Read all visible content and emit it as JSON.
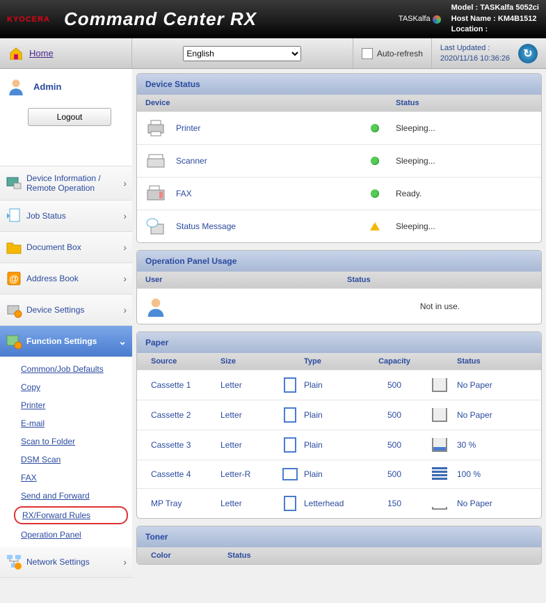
{
  "brand": "KYOCERA",
  "product": "Command Center",
  "product_suffix": "RX",
  "taskalfa": "TASKalfa",
  "host": {
    "model_label": "Model :",
    "model": "TASKalfa 5052ci",
    "hostname_label": "Host Name :",
    "hostname": "KM4B1512",
    "location_label": "Location :",
    "location": ""
  },
  "topbar": {
    "home": "Home",
    "language": "English",
    "auto_refresh": "Auto-refresh",
    "last_updated_label": "Last Updated :",
    "last_updated": "2020/11/16 10:36:26"
  },
  "user": {
    "name": "Admin",
    "logout": "Logout"
  },
  "nav": [
    {
      "label": "Device Information / Remote Operation"
    },
    {
      "label": "Job Status"
    },
    {
      "label": "Document Box"
    },
    {
      "label": "Address Book"
    },
    {
      "label": "Device Settings"
    },
    {
      "label": "Function Settings",
      "active": true
    },
    {
      "label": "Network Settings"
    }
  ],
  "function_settings_sub": [
    "Common/Job Defaults",
    "Copy",
    "Printer",
    "E-mail",
    "Scan to Folder",
    "DSM Scan",
    "FAX",
    "Send and Forward",
    "RX/Forward Rules",
    "Operation Panel"
  ],
  "device_status": {
    "title": "Device Status",
    "cols": {
      "device": "Device",
      "status": "Status"
    },
    "rows": [
      {
        "name": "Printer",
        "status": "Sleeping...",
        "ind": "ok"
      },
      {
        "name": "Scanner",
        "status": "Sleeping...",
        "ind": "ok"
      },
      {
        "name": "FAX",
        "status": "Ready.",
        "ind": "ok"
      },
      {
        "name": "Status Message",
        "status": "Sleeping...",
        "ind": "warn"
      }
    ]
  },
  "op_panel": {
    "title": "Operation Panel Usage",
    "cols": {
      "user": "User",
      "status": "Status"
    },
    "status": "Not in use."
  },
  "paper": {
    "title": "Paper",
    "cols": {
      "source": "Source",
      "size": "Size",
      "type": "Type",
      "capacity": "Capacity",
      "status": "Status"
    },
    "rows": [
      {
        "source": "Cassette 1",
        "size": "Letter",
        "orient": "p",
        "type": "Plain",
        "capacity": "500",
        "level": "none",
        "status": "No Paper"
      },
      {
        "source": "Cassette 2",
        "size": "Letter",
        "orient": "p",
        "type": "Plain",
        "capacity": "500",
        "level": "none",
        "status": "No Paper"
      },
      {
        "source": "Cassette 3",
        "size": "Letter",
        "orient": "p",
        "type": "Plain",
        "capacity": "500",
        "level": "p30",
        "status": "30 %"
      },
      {
        "source": "Cassette 4",
        "size": "Letter-R",
        "orient": "r",
        "type": "Plain",
        "capacity": "500",
        "level": "full",
        "status": "100 %"
      },
      {
        "source": "MP Tray",
        "size": "Letter",
        "orient": "p",
        "type": "Letterhead",
        "capacity": "150",
        "level": "flat",
        "status": "No Paper"
      }
    ]
  },
  "toner": {
    "title": "Toner",
    "cols": {
      "color": "Color",
      "status": "Status"
    }
  }
}
